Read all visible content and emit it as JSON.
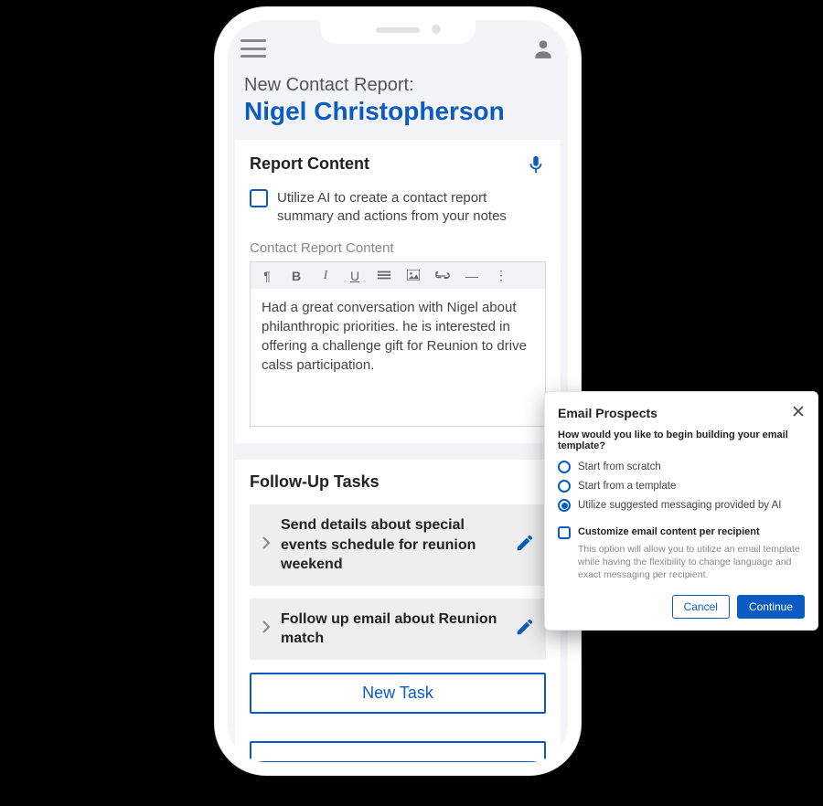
{
  "page": {
    "title_label": "New Contact Report:",
    "contact_name": "Nigel Christopherson"
  },
  "report": {
    "section_title": "Report Content",
    "ai_checkbox_label": "Utilize AI to create a contact report summary and actions from your notes",
    "field_label": "Contact Report Content",
    "body": "Had a great conversation with Nigel about philanthropic priorities. he is interested in offering a challenge gift for Reunion to drive calss participation."
  },
  "tasks": {
    "section_title": "Follow-Up Tasks",
    "items": [
      {
        "text": "Send details about special events schedule for reunion weekend"
      },
      {
        "text": "Follow up email about Reunion match"
      }
    ],
    "new_task_label": "New Task"
  },
  "dialog": {
    "title": "Email Prospects",
    "question": "How would you like to begin building your email template?",
    "options": [
      "Start from scratch",
      "Start from a template",
      "Utilize suggested messaging provided by AI"
    ],
    "selected_index": 2,
    "customize_label": "Customize email content per recipient",
    "customize_hint": "This option will allow you to utilize an email template while having the flexibility to change language and exact messaging per recipient.",
    "cancel_label": "Cancel",
    "continue_label": "Continue"
  }
}
